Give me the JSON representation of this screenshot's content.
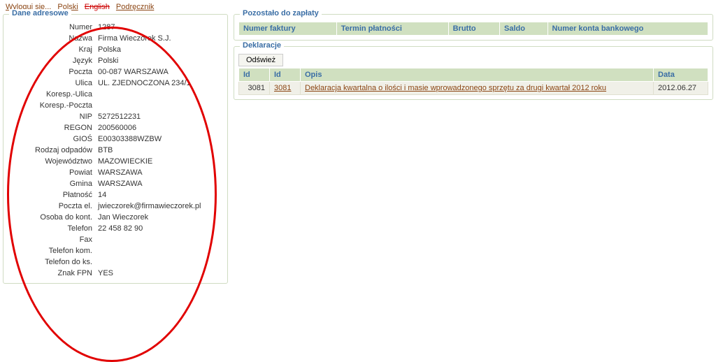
{
  "topbar": {
    "logout": "Wyloguj się...",
    "lang_pl": "Polski",
    "lang_en": "English",
    "manual": "Podręcznik"
  },
  "address_panel": {
    "title": "Dane adresowe",
    "rows": [
      {
        "label": "Numer",
        "value": "1287"
      },
      {
        "label": "Nazwa",
        "value": "Firma Wieczorek S.J."
      },
      {
        "label": "Kraj",
        "value": "Polska"
      },
      {
        "label": "Język",
        "value": "Polski"
      },
      {
        "label": "Poczta",
        "value": "00-087 WARSZAWA"
      },
      {
        "label": "Ulica",
        "value": "UL. ZJEDNOCZONA 234/1"
      },
      {
        "label": "Koresp.-Ulica",
        "value": ""
      },
      {
        "label": "Koresp.-Poczta",
        "value": ""
      },
      {
        "label": "NIP",
        "value": "5272512231"
      },
      {
        "label": "REGON",
        "value": "200560006"
      },
      {
        "label": "GIOŚ",
        "value": "E00303388WZBW"
      },
      {
        "label": "Rodzaj odpadów",
        "value": "BTB"
      },
      {
        "label": "Województwo",
        "value": "MAZOWIECKIE"
      },
      {
        "label": "Powiat",
        "value": "WARSZAWA"
      },
      {
        "label": "Gmina",
        "value": "WARSZAWA"
      },
      {
        "label": "Płatność",
        "value": "14"
      },
      {
        "label": "Poczta el.",
        "value": "jwieczorek@firmawieczorek.pl"
      },
      {
        "label": "Osoba do kont.",
        "value": "Jan Wieczorek"
      },
      {
        "label": "Telefon",
        "value": "22 458 82 90"
      },
      {
        "label": "Fax",
        "value": ""
      },
      {
        "label": "Telefon kom.",
        "value": ""
      },
      {
        "label": "Telefon do ks.",
        "value": ""
      },
      {
        "label": "Znak FPN",
        "value": "YES"
      }
    ]
  },
  "payments_panel": {
    "title": "Pozostało do zapłaty",
    "headers": [
      "Numer faktury",
      "Termin płatności",
      "Brutto",
      "Saldo",
      "Numer konta bankowego"
    ]
  },
  "declarations_panel": {
    "title": "Deklaracje",
    "refresh": "Odśwież",
    "headers": {
      "id1": "Id",
      "id2": "Id",
      "desc": "Opis",
      "date": "Data"
    },
    "rows": [
      {
        "id1": "3081",
        "id2": "3081",
        "desc": "Deklaracja kwartalna o ilości i masie wprowadzonego sprzętu za drugi kwartał 2012 roku",
        "date": "2012.06.27"
      }
    ]
  }
}
